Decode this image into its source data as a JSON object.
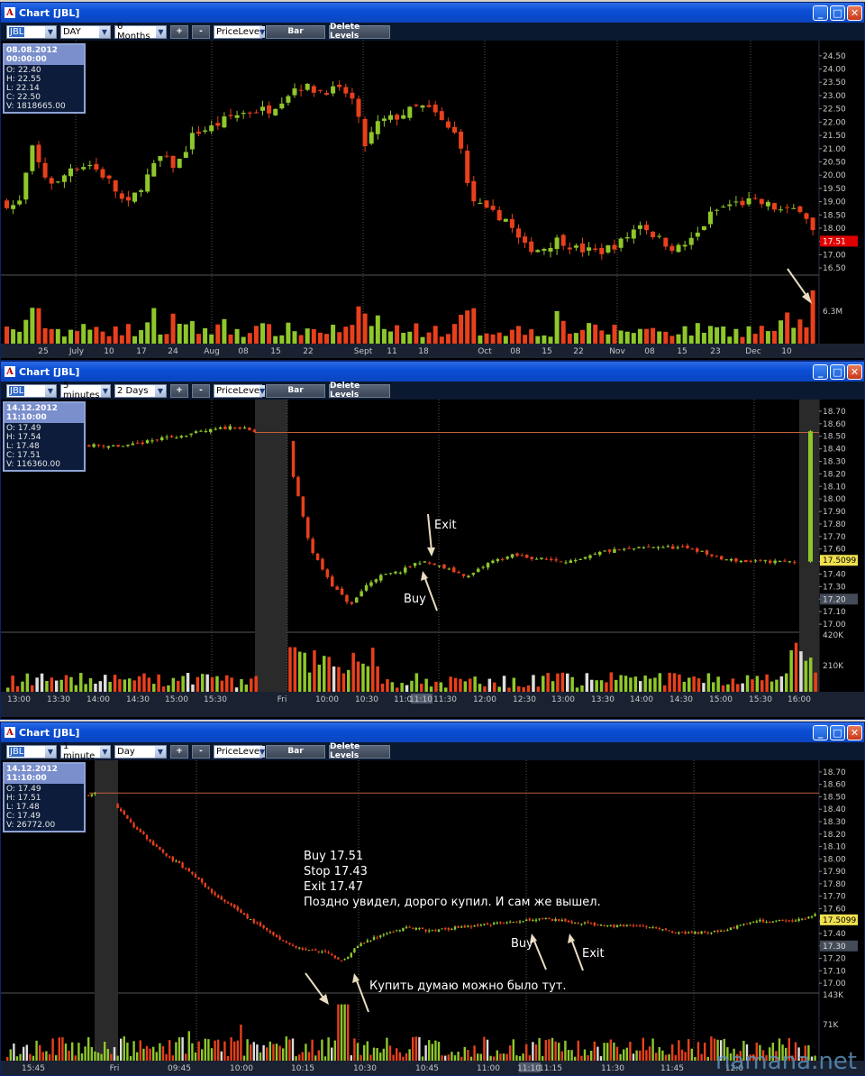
{
  "watermark": "namana.net",
  "windows": [
    {
      "title": "Chart [JBL]",
      "ticker": "JBL",
      "interval": "DAY",
      "range": "6 Months",
      "plus": "+",
      "minus": "-",
      "price_level": "PriceLeve",
      "bar_label": "Bar",
      "delete_levels": "Delete Levels",
      "info": {
        "datetime": "08.08.2012 00:00:00",
        "o": "O: 22.40",
        "h": "H: 22.55",
        "l": "L: 22.14",
        "c": "C: 22.50",
        "v": "V: 1818665.00"
      },
      "price_ticks": [
        "24.50",
        "24.00",
        "23.50",
        "23.00",
        "22.50",
        "22.00",
        "21.50",
        "21.00",
        "20.50",
        "20.00",
        "19.50",
        "19.00",
        "18.50",
        "18.00",
        "17.50",
        "17.00",
        "16.50"
      ],
      "current_price": "17.51",
      "volume_label": "6.3M",
      "time_ticks": [
        "25",
        "July",
        "10",
        "17",
        "24",
        "Aug",
        "08",
        "15",
        "22",
        "Sept",
        "11",
        "18",
        "Oct",
        "08",
        "15",
        "22",
        "Nov",
        "08",
        "15",
        "23",
        "Dec",
        "10"
      ],
      "colors": {
        "up": "#8fc72b",
        "down": "#e8401c",
        "price_label": "#e00000"
      }
    },
    {
      "title": "Chart [JBL]",
      "ticker": "JBL",
      "interval": "5 minutes",
      "range": "2 Days",
      "plus": "+",
      "minus": "-",
      "price_level": "PriceLeve",
      "bar_label": "Bar",
      "delete_levels": "Delete Levels",
      "info": {
        "datetime": "14.12.2012 11:10:00",
        "o": "O: 17.49",
        "h": "H: 17.54",
        "l": "L: 17.48",
        "c": "C: 17.51",
        "v": "V: 116360.00"
      },
      "price_ticks": [
        "18.70",
        "18.60",
        "18.50",
        "18.40",
        "18.30",
        "18.20",
        "18.10",
        "18.00",
        "17.90",
        "17.80",
        "17.70",
        "17.60",
        "17.50",
        "17.40",
        "17.30",
        "17.20",
        "17.10",
        "17.00"
      ],
      "current_price": "17.5099",
      "cursor_price": "17.20",
      "volume_labels": [
        "420K",
        "210K"
      ],
      "time_ticks": [
        "13:00",
        "13:30",
        "14:00",
        "14:30",
        "15:00",
        "15:30",
        "Fri",
        "10:00",
        "10:30",
        "11:00",
        "11:10",
        "11:30",
        "12:00",
        "12:30",
        "13:00",
        "13:30",
        "14:00",
        "14:30",
        "15:00",
        "15:30",
        "16:00"
      ],
      "annotations": [
        "Exit",
        "Buy"
      ]
    },
    {
      "title": "Chart [JBL]",
      "ticker": "JBL",
      "interval": "1 minute",
      "range": "Day",
      "plus": "+",
      "minus": "-",
      "price_level": "PriceLeve",
      "bar_label": "Bar",
      "delete_levels": "Delete Levels",
      "info": {
        "datetime": "14.12.2012 11:10:00",
        "o": "O: 17.49",
        "h": "H: 17.51",
        "l": "L: 17.48",
        "c": "C: 17.49",
        "v": "V: 26772.00"
      },
      "price_ticks": [
        "18.70",
        "18.60",
        "18.50",
        "18.40",
        "18.30",
        "18.20",
        "18.10",
        "18.00",
        "17.90",
        "17.80",
        "17.70",
        "17.60",
        "17.50",
        "17.40",
        "17.30",
        "17.20",
        "17.10",
        "17.00"
      ],
      "current_price": "17.5099",
      "cursor_price": "17.30",
      "volume_labels": [
        "143K",
        "71K"
      ],
      "time_ticks": [
        "15:45",
        "Fri",
        "09:45",
        "10:00",
        "10:15",
        "10:30",
        "10:45",
        "11:00",
        "11:10",
        "11:15",
        "11:30",
        "11:45",
        "12:0"
      ],
      "annotations": [
        "Buy 17.51",
        "Stop 17.43",
        "Exit 17.47",
        "Поздно увидел, дорого купил. И сам же вышел.",
        "Купить думаю можно было тут.",
        "Buy",
        "Exit"
      ]
    }
  ]
}
